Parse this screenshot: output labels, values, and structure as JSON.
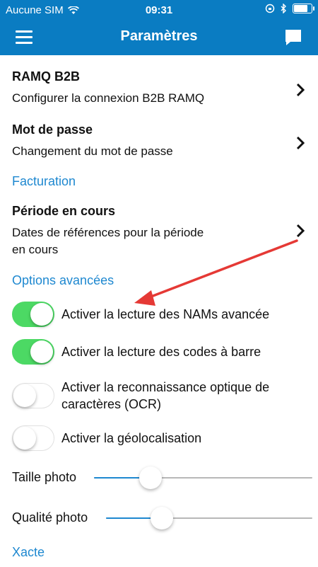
{
  "status_bar": {
    "carrier": "Aucune SIM",
    "time": "09:31",
    "battery_level": 0.9
  },
  "nav": {
    "title": "Paramètres",
    "menu_icon": "hamburger-menu-icon",
    "chat_icon": "chat-bubble-icon"
  },
  "items": [
    {
      "title": "RAMQ B2B",
      "subtitle": "Configurer la connexion B2B RAMQ"
    },
    {
      "title": "Mot de passe",
      "subtitle": "Changement du mot de passe"
    }
  ],
  "categories": {
    "billing": "Facturation",
    "advanced": "Options avancées",
    "xacte": "Xacte"
  },
  "period": {
    "title": "Période en cours",
    "subtitle_line1": "Dates de références pour la période",
    "subtitle_line2": "en cours"
  },
  "toggles": [
    {
      "label": "Activer la lecture des NAMs avancée",
      "on": true
    },
    {
      "label": "Activer la lecture des codes à barre",
      "on": true
    },
    {
      "label_line1": "Activer la reconnaissance optique de",
      "label_line2": "caractères (OCR)",
      "on": false
    },
    {
      "label": "Activer la géolocalisation",
      "on": false
    }
  ],
  "sliders": [
    {
      "label": "Taille photo",
      "value": 0.26
    },
    {
      "label": "Qualité photo",
      "value": 0.27
    }
  ],
  "colors": {
    "header": "#0a7cc2",
    "accent": "#1e88d0",
    "toggle_on": "#4cd964",
    "annotation_arrow": "#e53935"
  }
}
